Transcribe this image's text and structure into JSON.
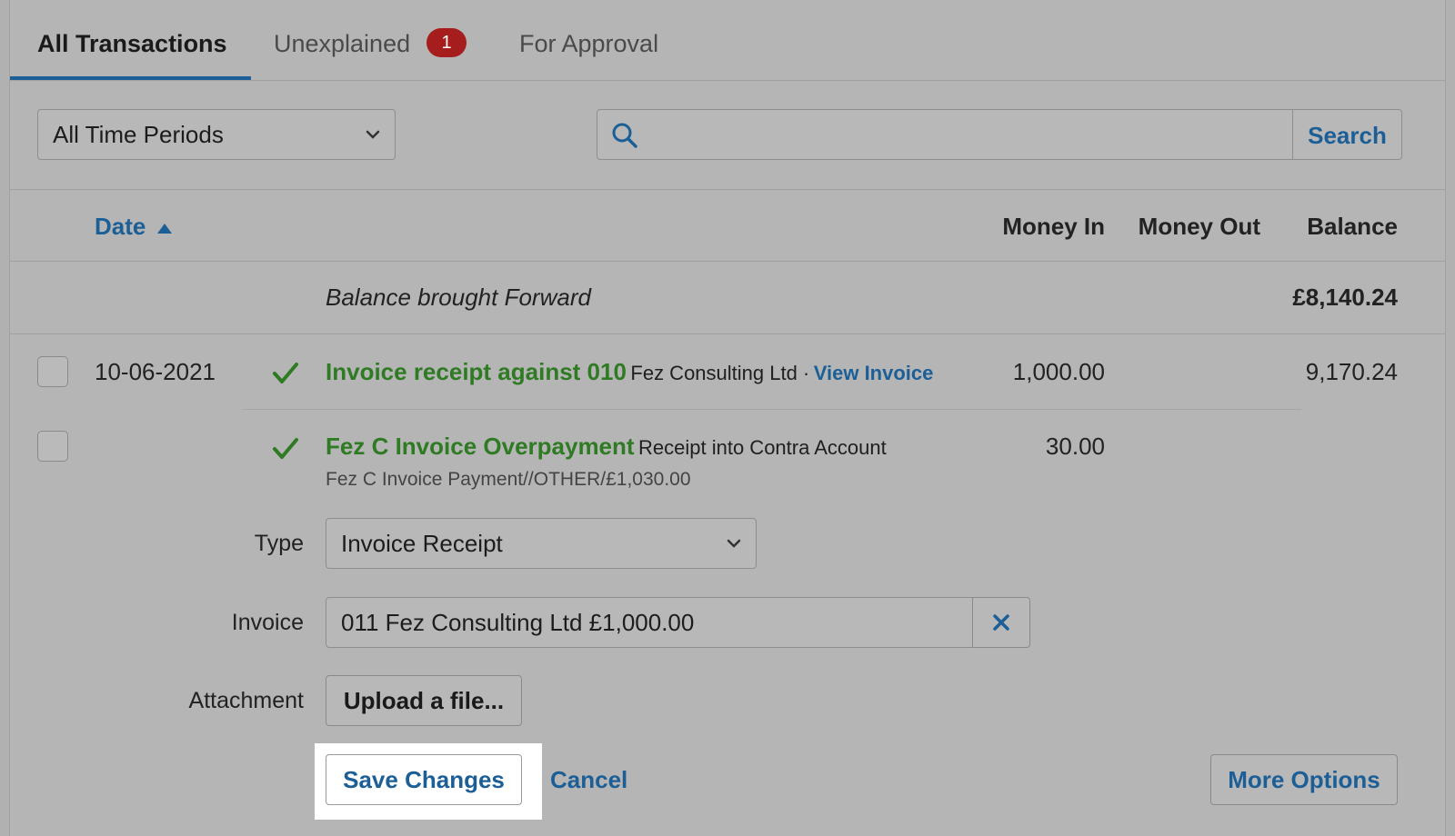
{
  "tabs": [
    {
      "label": "All Transactions",
      "active": true
    },
    {
      "label": "Unexplained",
      "badge": "1"
    },
    {
      "label": "For Approval"
    }
  ],
  "filters": {
    "period_value": "All Time Periods",
    "search_value": "",
    "search_button": "Search"
  },
  "table": {
    "headers": {
      "date": "Date",
      "money_in": "Money In",
      "money_out": "Money Out",
      "balance": "Balance"
    },
    "balance_forward": {
      "label": "Balance brought Forward",
      "amount": "£8,140.24"
    },
    "rows": [
      {
        "date": "10-06-2021",
        "title": "Invoice receipt against 010",
        "detail": "Fez Consulting Ltd ·",
        "link": "View Invoice",
        "money_in": "1,000.00",
        "balance": "9,170.24"
      },
      {
        "title": "Fez C Invoice Overpayment",
        "detail": "Receipt into Contra Account",
        "subline": "Fez C Invoice Payment//OTHER/£1,030.00",
        "money_in": "30.00"
      }
    ]
  },
  "form": {
    "type_label": "Type",
    "type_value": "Invoice Receipt",
    "invoice_label": "Invoice",
    "invoice_value": "011 Fez Consulting Ltd £1,000.00",
    "attachment_label": "Attachment",
    "upload_button": "Upload a file...",
    "save_button": "Save Changes",
    "cancel_button": "Cancel",
    "more_options_button": "More Options"
  },
  "colors": {
    "accent_blue": "#1c5f97",
    "success_green": "#2f7b23",
    "badge_red": "#a51d1d"
  }
}
